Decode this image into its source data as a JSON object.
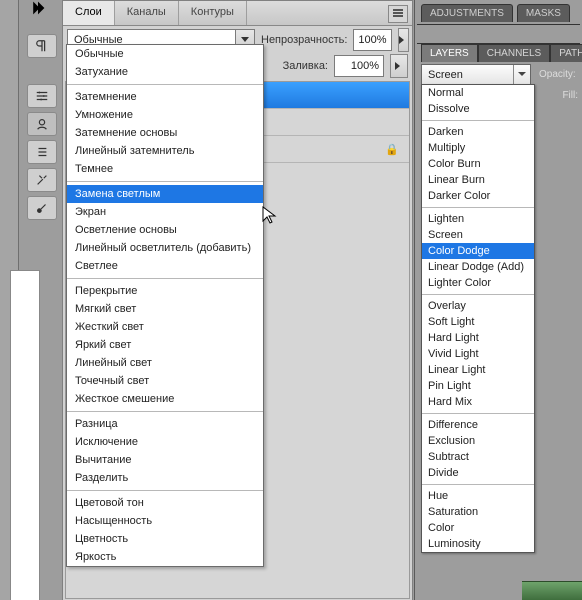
{
  "panelL": {
    "tabs": [
      "Слои",
      "Каналы",
      "Контуры"
    ],
    "active_tab": 0,
    "blend_selected": "Обычные",
    "opacity_label": "Непрозрачность:",
    "opacity_value": "100%",
    "fill_label": "Заливка:",
    "fill_value": "100%"
  },
  "dropdownL": {
    "hl_index": 7,
    "groups": [
      [
        "Обычные",
        "Затухание"
      ],
      [
        "Затемнение",
        "Умножение",
        "Затемнение основы",
        "Линейный затемнитель",
        "Темнее"
      ],
      [
        "Замена светлым",
        "Экран",
        "Осветление основы",
        "Линейный осветлитель (добавить)",
        "Светлее"
      ],
      [
        "Перекрытие",
        "Мягкий свет",
        "Жесткий свет",
        "Яркий свет",
        "Линейный свет",
        "Точечный свет",
        "Жесткое смешение"
      ],
      [
        "Разница",
        "Исключение",
        "Вычитание",
        "Разделить"
      ],
      [
        "Цветовой тон",
        "Насыщенность",
        "Цветность",
        "Яркость"
      ]
    ]
  },
  "panelR": {
    "top_tabs": [
      "ADJUSTMENTS",
      "MASKS"
    ],
    "tabs2": [
      "LAYERS",
      "CHANNELS",
      "PATHS"
    ],
    "active_tab2": 0,
    "blend_selected": "Screen",
    "opacity_label": "Opacity:",
    "fill_label": "Fill:"
  },
  "dropdownR": {
    "hl_index": 9,
    "groups": [
      [
        "Normal",
        "Dissolve"
      ],
      [
        "Darken",
        "Multiply",
        "Color Burn",
        "Linear Burn",
        "Darker Color"
      ],
      [
        "Lighten",
        "Screen",
        "Color Dodge",
        "Linear Dodge (Add)",
        "Lighter Color"
      ],
      [
        "Overlay",
        "Soft Light",
        "Hard Light",
        "Vivid Light",
        "Linear Light",
        "Pin Light",
        "Hard Mix"
      ],
      [
        "Difference",
        "Exclusion",
        "Subtract",
        "Divide"
      ],
      [
        "Hue",
        "Saturation",
        "Color",
        "Luminosity"
      ]
    ]
  }
}
